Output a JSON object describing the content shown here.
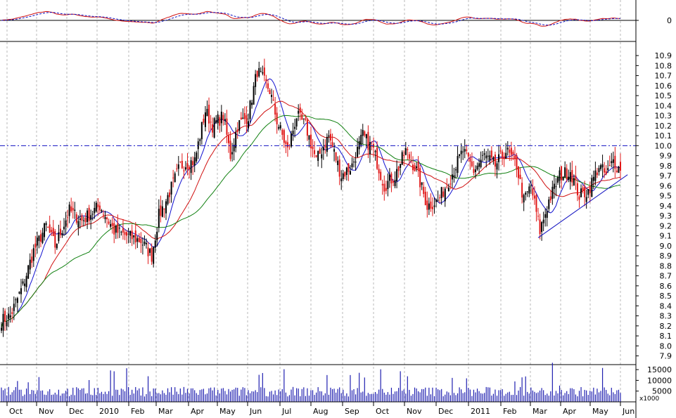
{
  "chart_data": {
    "type": "candlestick",
    "x_tick_labels": [
      "Oct",
      "Nov",
      "Dec",
      "2010",
      "Feb",
      "Mar",
      "Apr",
      "May",
      "Jun",
      "Jul",
      "Aug",
      "Sep",
      "Oct",
      "Nov",
      "Dec",
      "2011",
      "Feb",
      "Mar",
      "Apr",
      "May",
      "Jun"
    ],
    "price_ticks": [
      "7.9",
      "8.0",
      "8.1",
      "8.2",
      "8.3",
      "8.4",
      "8.5",
      "8.6",
      "8.7",
      "8.8",
      "8.9",
      "9.0",
      "9.1",
      "9.2",
      "9.3",
      "9.4",
      "9.5",
      "9.6",
      "9.7",
      "9.8",
      "9.9",
      "10.0",
      "10.1",
      "10.2",
      "10.3",
      "10.4",
      "10.5",
      "10.6",
      "10.7",
      "10.8",
      "10.9"
    ],
    "price_range": [
      7.82,
      11.02
    ],
    "reference_level": 10.0,
    "oscillator_tick": "0",
    "volume_ticks": [
      "5000",
      "10000",
      "15000"
    ],
    "volume_unit": "x1000",
    "price_anchor_points": [
      {
        "day": 0,
        "price": 8.25
      },
      {
        "day": 5,
        "price": 8.3
      },
      {
        "day": 12,
        "price": 8.6
      },
      {
        "day": 18,
        "price": 8.95
      },
      {
        "day": 25,
        "price": 9.2
      },
      {
        "day": 30,
        "price": 9.0
      },
      {
        "day": 38,
        "price": 9.35
      },
      {
        "day": 45,
        "price": 9.25
      },
      {
        "day": 55,
        "price": 9.4
      },
      {
        "day": 63,
        "price": 9.15
      },
      {
        "day": 70,
        "price": 9.1
      },
      {
        "day": 78,
        "price": 9.05
      },
      {
        "day": 84,
        "price": 8.9
      },
      {
        "day": 88,
        "price": 9.3
      },
      {
        "day": 92,
        "price": 9.45
      },
      {
        "day": 100,
        "price": 9.8
      },
      {
        "day": 108,
        "price": 9.85
      },
      {
        "day": 114,
        "price": 10.35
      },
      {
        "day": 118,
        "price": 10.2
      },
      {
        "day": 124,
        "price": 10.3
      },
      {
        "day": 128,
        "price": 9.9
      },
      {
        "day": 132,
        "price": 10.2
      },
      {
        "day": 138,
        "price": 10.3
      },
      {
        "day": 143,
        "price": 10.75
      },
      {
        "day": 150,
        "price": 10.55
      },
      {
        "day": 154,
        "price": 10.25
      },
      {
        "day": 160,
        "price": 9.95
      },
      {
        "day": 165,
        "price": 10.3
      },
      {
        "day": 170,
        "price": 10.2
      },
      {
        "day": 176,
        "price": 9.85
      },
      {
        "day": 183,
        "price": 10.1
      },
      {
        "day": 190,
        "price": 9.7
      },
      {
        "day": 196,
        "price": 9.8
      },
      {
        "day": 202,
        "price": 10.1
      },
      {
        "day": 208,
        "price": 9.95
      },
      {
        "day": 214,
        "price": 9.6
      },
      {
        "day": 220,
        "price": 9.7
      },
      {
        "day": 226,
        "price": 9.95
      },
      {
        "day": 232,
        "price": 9.75
      },
      {
        "day": 238,
        "price": 9.4
      },
      {
        "day": 244,
        "price": 9.45
      },
      {
        "day": 250,
        "price": 9.65
      },
      {
        "day": 258,
        "price": 9.95
      },
      {
        "day": 264,
        "price": 9.75
      },
      {
        "day": 270,
        "price": 9.9
      },
      {
        "day": 276,
        "price": 9.8
      },
      {
        "day": 282,
        "price": 9.95
      },
      {
        "day": 288,
        "price": 9.8
      },
      {
        "day": 292,
        "price": 9.45
      },
      {
        "day": 296,
        "price": 9.6
      },
      {
        "day": 301,
        "price": 9.15
      },
      {
        "day": 306,
        "price": 9.45
      },
      {
        "day": 312,
        "price": 9.7
      },
      {
        "day": 318,
        "price": 9.75
      },
      {
        "day": 323,
        "price": 9.5
      },
      {
        "day": 328,
        "price": 9.55
      },
      {
        "day": 334,
        "price": 9.8
      },
      {
        "day": 338,
        "price": 9.7
      },
      {
        "day": 342,
        "price": 9.85
      },
      {
        "day": 346,
        "price": 9.75
      }
    ],
    "trendline": [
      {
        "day": 300,
        "price": 9.08
      },
      {
        "day": 350,
        "price": 9.71
      }
    ]
  }
}
